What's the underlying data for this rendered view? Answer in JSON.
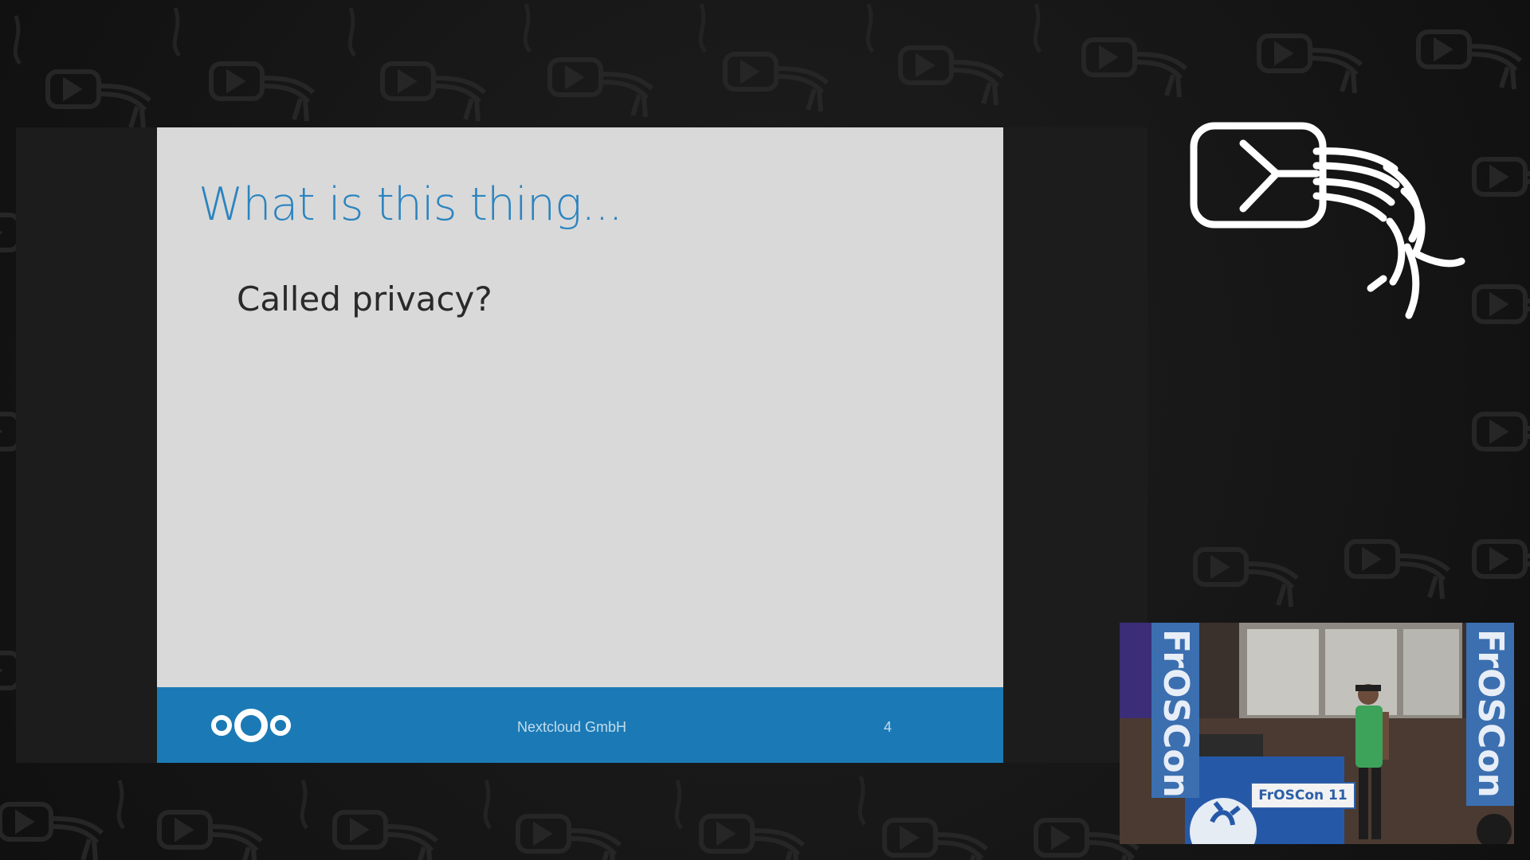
{
  "slide": {
    "title": "What is this thing...",
    "bullet": "Called privacy?",
    "footer": {
      "logo_icon": "nextcloud-logo-icon",
      "company": "Nextcloud GmbH",
      "page_number": "4"
    }
  },
  "branding": {
    "logo_icon": "conference-stream-logo-icon"
  },
  "speaker_video": {
    "banner_left_text": "FrOSCon",
    "banner_right_text": "FrOSCon",
    "podium_sign_text": "FrOSCon 11"
  },
  "colors": {
    "background": "#151515",
    "slide_background": "#d9d9d9",
    "title_blue": "#2b84bf",
    "footer_blue": "#1b7ab5"
  }
}
